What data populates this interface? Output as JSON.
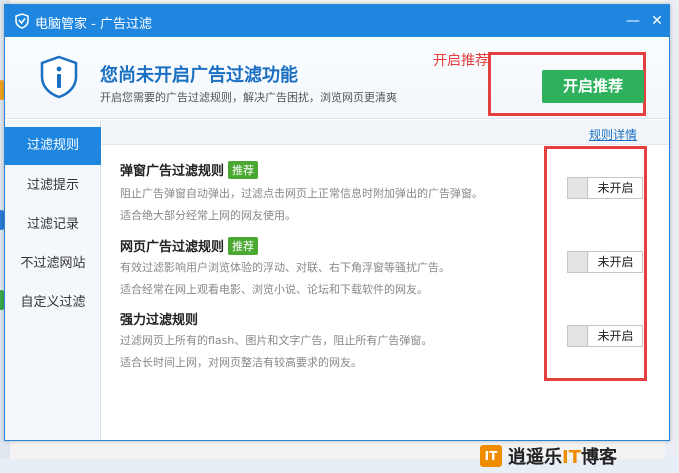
{
  "window": {
    "title": "电脑管家 - 广告过滤",
    "minimize_glyph": "—",
    "close_glyph": "✕"
  },
  "banner": {
    "title": "您尚未开启广告过滤功能",
    "subtitle": "开启您需要的广告过滤规则，解决广告困扰，浏览网页更清爽",
    "enable_button": "开启推荐",
    "annotation": "开启推荐"
  },
  "sidebar": {
    "items": [
      {
        "label": "过滤规则",
        "active": true
      },
      {
        "label": "过滤提示",
        "active": false
      },
      {
        "label": "过滤记录",
        "active": false
      },
      {
        "label": "不过滤网站",
        "active": false
      },
      {
        "label": "自定义过滤",
        "active": false
      }
    ]
  },
  "content": {
    "rules_link": "规则详情",
    "rules": [
      {
        "title": "弹窗广告过滤规则",
        "tag": "推荐",
        "desc1": "阻止广告弹窗自动弹出，过滤点击网页上正常信息时附加弹出的广告弹窗。",
        "desc2": "适合绝大部分经常上网的网友使用。",
        "toggle": "未开启"
      },
      {
        "title": "网页广告过滤规则",
        "tag": "推荐",
        "desc1": "有效过滤影响用户浏览体验的浮动、对联、右下角浮窗等骚扰广告。",
        "desc2": "适合经常在网上观看电影、浏览小说、论坛和下载软件的网友。",
        "toggle": "未开启"
      },
      {
        "title": "强力过滤规则",
        "tag": "",
        "desc1": "过滤网页上所有的flash、图片和文字广告，阻止所有广告弹窗。",
        "desc2": "适合长时间上网，对网页整洁有较高要求的网友。",
        "toggle": "未开启"
      }
    ]
  },
  "watermark": {
    "logo": "IT",
    "text_a": "逍遥乐",
    "text_b": "IT",
    "text_c": "博客"
  },
  "colors": {
    "accent": "#1f86e0",
    "enable_green": "#2db15d",
    "tag_green": "#4aa832",
    "annotation_red": "#e4403f"
  }
}
